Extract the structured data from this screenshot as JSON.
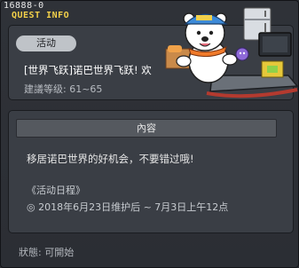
{
  "header": {
    "quest_id": "16888-0",
    "title": "QUEST INFO"
  },
  "quest": {
    "tag": "活动",
    "name": "[世界飞跃]诺巴世界飞跃! 欢",
    "level": "建議等级: 61~65"
  },
  "content": {
    "section_title": "內容",
    "description": "移居诺巴世界的好机会，不要错过哦!",
    "schedule_label": "《活动日程》",
    "schedule_text": "◎ 2018年6月23日维护后 ~ 7月3日上午12点"
  },
  "footer": {
    "status": "狀態: 可開始"
  },
  "colors": {
    "title": "#f2d04a",
    "panel": "#3a3e45",
    "window": "#2f3238"
  }
}
